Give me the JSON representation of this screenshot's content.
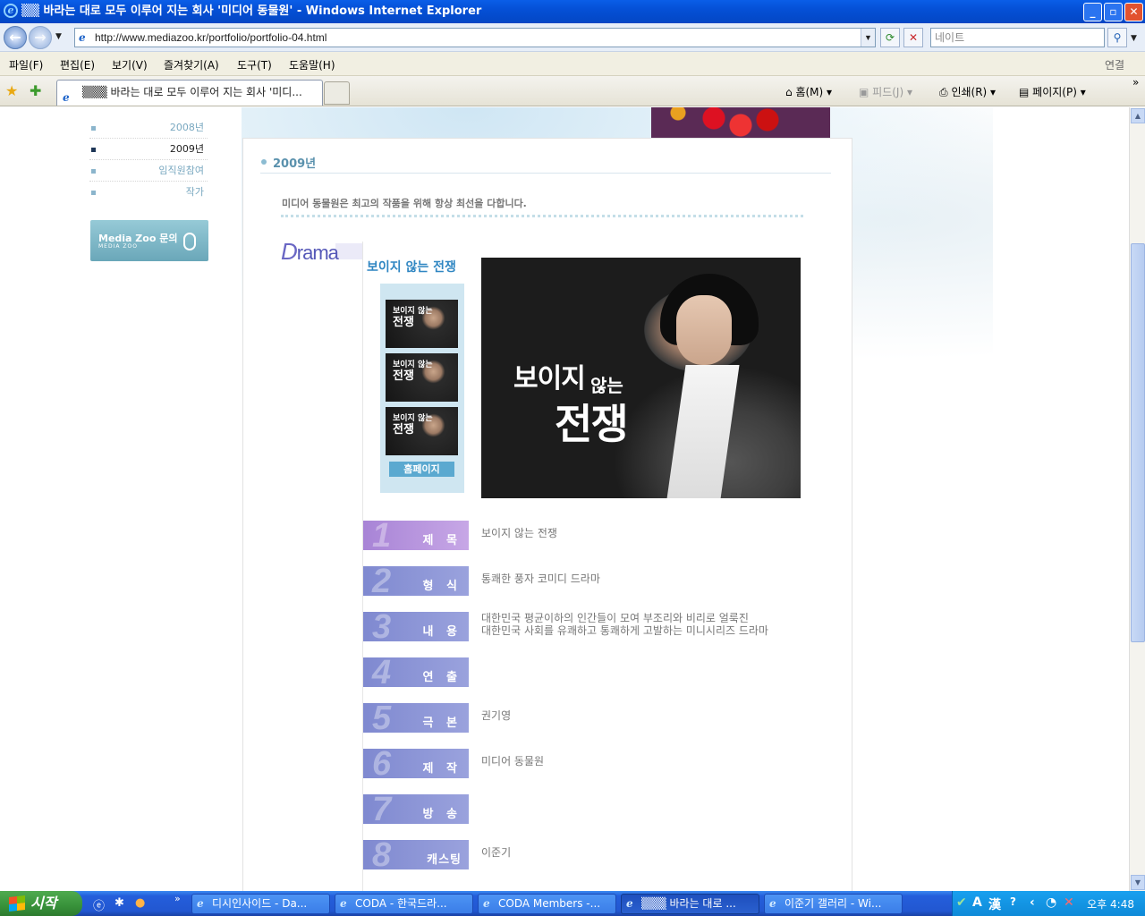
{
  "window": {
    "title": "▒▒ 바라는 대로 모두 이루어 지는 회사 '미디어 동물원' - Windows Internet Explorer",
    "min_label": "_",
    "max_label": "▫",
    "close_label": "✕"
  },
  "addressbar": {
    "url": "http://www.mediazoo.kr/portfolio/portfolio-04.html",
    "search_placeholder": "네이트",
    "back_glyph": "←",
    "forward_glyph": "→"
  },
  "menubar": {
    "items": [
      "파일(F)",
      "편집(E)",
      "보기(V)",
      "즐겨찾기(A)",
      "도구(T)",
      "도움말(H)"
    ],
    "right": "연결"
  },
  "tabs": {
    "active": "▒▒▒ 바라는 대로 모두 이루어 지는 회사 '미디...",
    "home": "홈(M)",
    "feed": "피드(J)",
    "print": "인쇄(R)",
    "page": "페이지(P)",
    "more": "»"
  },
  "sidebar": {
    "items": [
      {
        "label": "2008년",
        "selected": false
      },
      {
        "label": "2009년",
        "selected": true
      },
      {
        "label": "임직원참여",
        "selected": false
      },
      {
        "label": "작가",
        "selected": false
      }
    ],
    "inquiry_title": "Media Zoo 문의",
    "inquiry_sub": "MEDIA ZOO"
  },
  "main": {
    "section_title": "2009년",
    "subtitle": "미디어 동물원은 최고의 작품을 위해 항상 최선을 다합니다.",
    "category_initial": "D",
    "category_rest": "rama",
    "show_title": "보이지 않는 전쟁",
    "thumb_small": "보이지 않는",
    "thumb_big": "전쟁",
    "homepage_button": "홈페이지",
    "poster_line1": "보이지",
    "poster_line2": "않는",
    "poster_line3": "전쟁"
  },
  "details": [
    {
      "num": "1",
      "label": "제 목",
      "value": "보이지 않는 전쟁"
    },
    {
      "num": "2",
      "label": "형 식",
      "value": "통쾌한 풍자 코미디 드라마"
    },
    {
      "num": "3",
      "label": "내 용",
      "value": "대한민국 평균이하의 인간들이 모여 부조리와 비리로 얼룩진",
      "value2": "대한민국 사회를 유쾌하고 통쾌하게 고발하는 미니시리즈 드라마"
    },
    {
      "num": "4",
      "label": "연 출",
      "value": ""
    },
    {
      "num": "5",
      "label": "극 본",
      "value": "권기영"
    },
    {
      "num": "6",
      "label": "제 작",
      "value": "미디어 동물원"
    },
    {
      "num": "7",
      "label": "방 송",
      "value": ""
    },
    {
      "num": "8",
      "label": "캐스팅",
      "value": "이준기"
    }
  ],
  "taskbar": {
    "start_label": "시작",
    "tasks": [
      {
        "label": "디시인사이드 - Da..."
      },
      {
        "label": "CODA - 한국드라..."
      },
      {
        "label": "CODA Members -..."
      },
      {
        "label": "▒▒▒ 바라는 대로 ..."
      },
      {
        "label": "이준기 갤러리 - Wi..."
      }
    ],
    "clock": "오후 4:48"
  }
}
